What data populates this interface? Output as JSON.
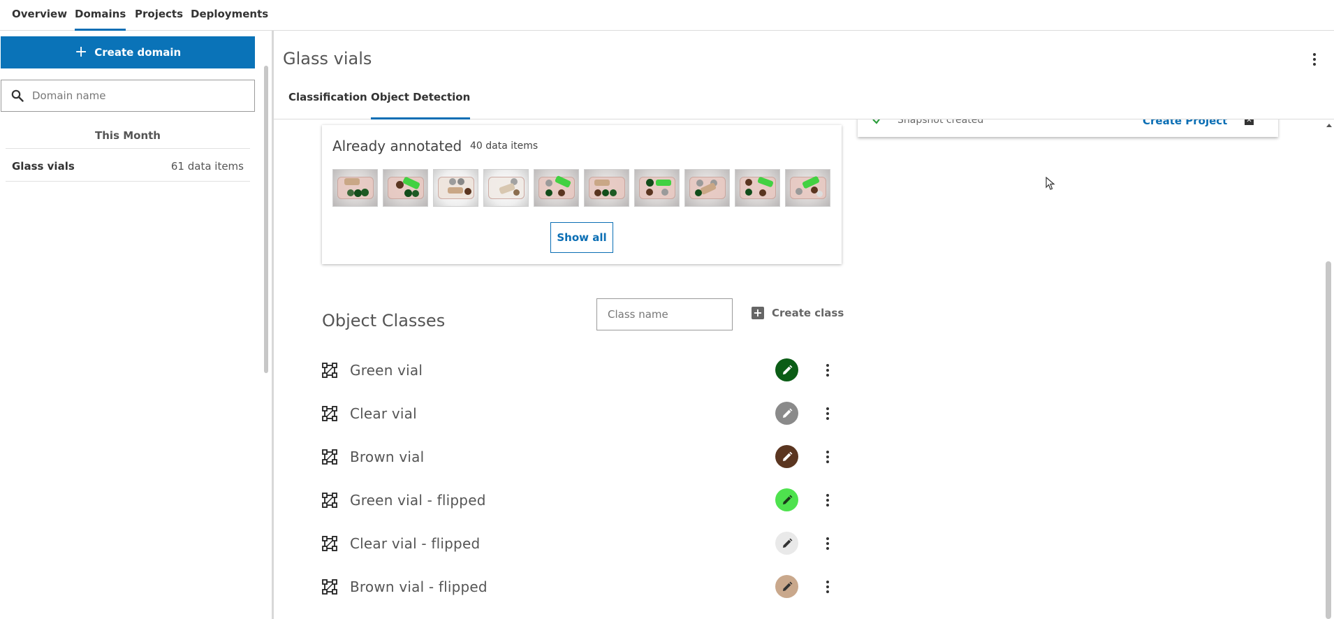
{
  "topnav": {
    "tabs": [
      {
        "label": "Overview"
      },
      {
        "label": "Domains",
        "active": true
      },
      {
        "label": "Projects"
      },
      {
        "label": "Deployments"
      }
    ]
  },
  "sidebar": {
    "create_label": "Create domain",
    "search_placeholder": "Domain name",
    "group_heading": "This Month",
    "domains": [
      {
        "name": "Glass vials",
        "count": "61 data items"
      }
    ]
  },
  "main": {
    "title": "Glass vials",
    "tabs": [
      {
        "label": "Classification"
      },
      {
        "label": "Object Detection",
        "active": true
      }
    ]
  },
  "toast": {
    "message": "Snapshot created",
    "action_label": "Create Project",
    "status_color": "#2e9e3e"
  },
  "annotated": {
    "title": "Already annotated",
    "count": "40 data items",
    "show_all_label": "Show all",
    "thumbnail_count": 10
  },
  "object_classes": {
    "title": "Object Classes",
    "input_placeholder": "Class name",
    "create_label": "Create class",
    "classes": [
      {
        "name": "Green vial",
        "color": "#0b5d16",
        "icon_color": "#ffffff"
      },
      {
        "name": "Clear vial",
        "color": "#8a8a8a",
        "icon_color": "#ffffff"
      },
      {
        "name": "Brown vial",
        "color": "#5a3520",
        "icon_color": "#ffffff"
      },
      {
        "name": "Green vial - flipped",
        "color": "#4ee24e",
        "icon_color": "#1a3a1a"
      },
      {
        "name": "Clear vial - flipped",
        "color": "#e9e9e9",
        "icon_color": "#333333"
      },
      {
        "name": "Brown vial - flipped",
        "color": "#c9a88c",
        "icon_color": "#333333"
      }
    ]
  },
  "theme": {
    "accent": "#0a73b8",
    "link": "#0a6eb4"
  }
}
